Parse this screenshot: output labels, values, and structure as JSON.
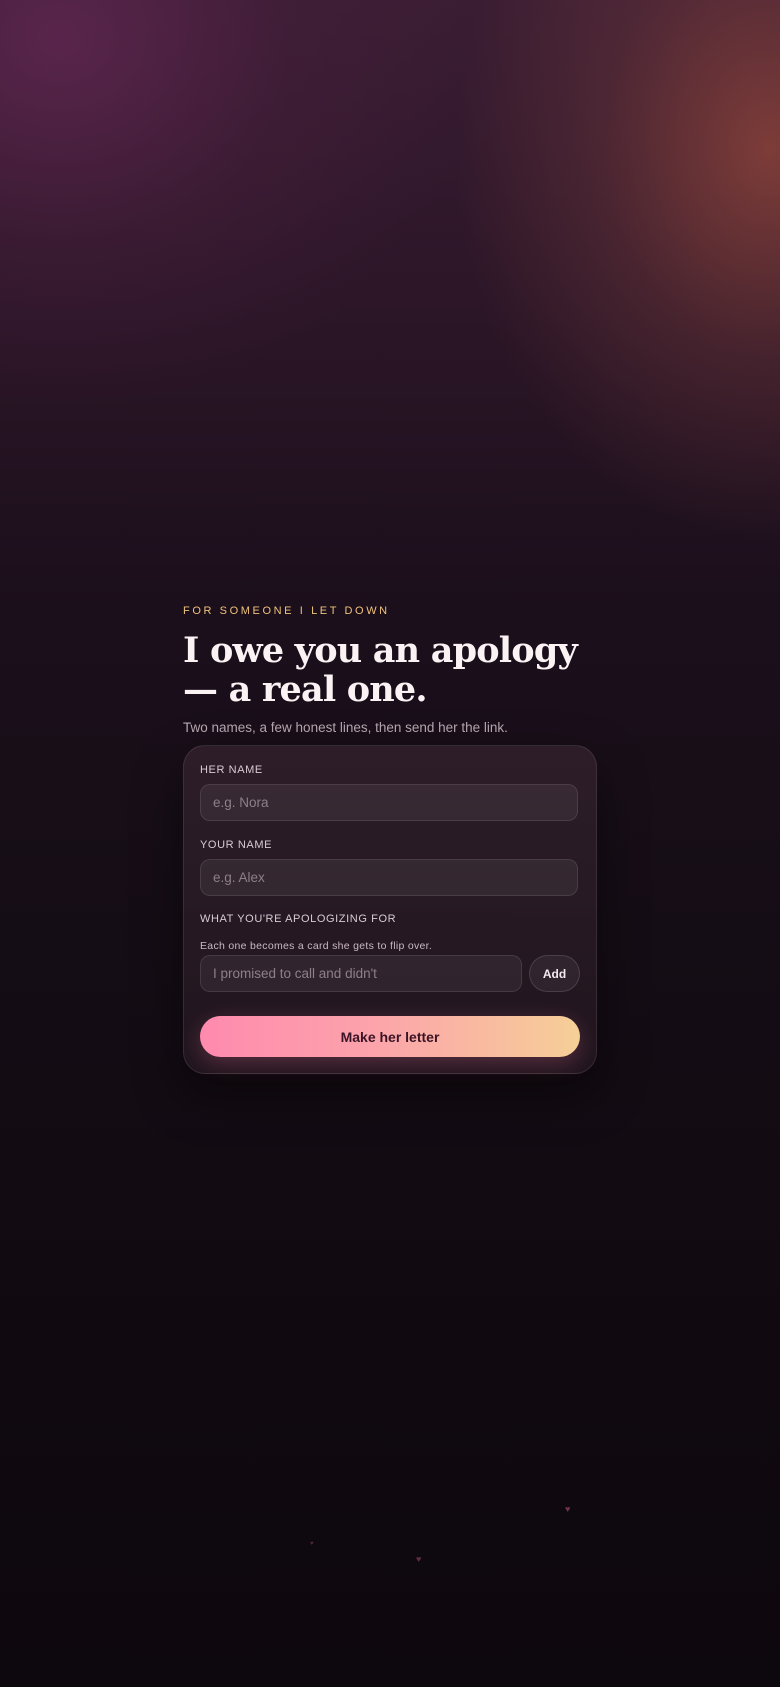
{
  "intro": {
    "eyebrow": "FOR SOMEONE I LET DOWN",
    "title": "I owe you an apology — a real one.",
    "subtitle": "Two names, a few honest lines, then send her the link."
  },
  "form": {
    "her_name": {
      "label": "HER NAME",
      "placeholder": "e.g. Nora",
      "value": ""
    },
    "your_name": {
      "label": "YOUR NAME",
      "placeholder": "e.g. Alex",
      "value": ""
    },
    "reasons": {
      "label": "WHAT YOU'RE APOLOGIZING FOR",
      "hint": "Each one becomes a card she gets to flip over.",
      "placeholder": "I promised to call and didn't",
      "add_label": "Add"
    },
    "submit_label": "Make her letter"
  },
  "decor": {
    "hearts": [
      "heart-icon",
      "heart-icon",
      "heart-icon"
    ]
  },
  "colors": {
    "accent_start": "#ff8aae",
    "accent_end": "#f6cf97",
    "eyebrow": "#f0c27a",
    "background": "#100a10"
  }
}
